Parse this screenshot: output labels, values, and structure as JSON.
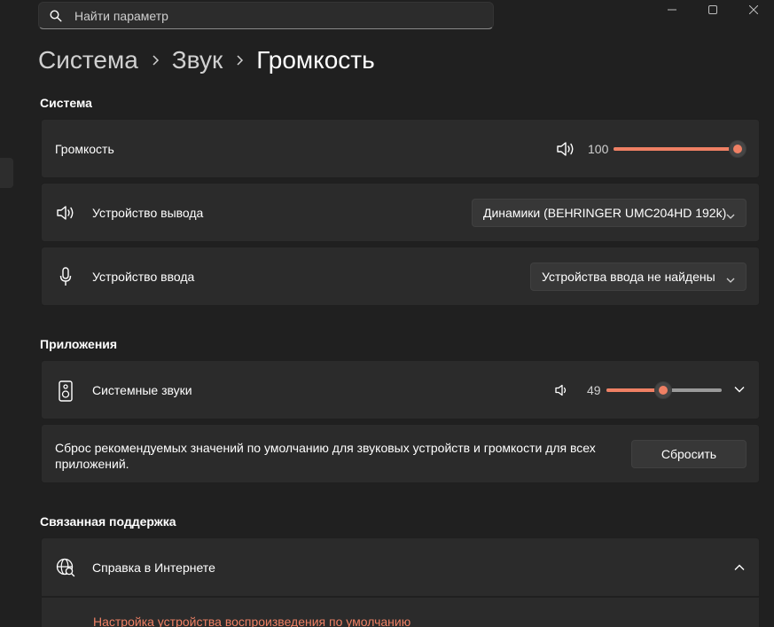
{
  "search": {
    "placeholder": "Найти параметр"
  },
  "breadcrumb": {
    "level1": "Система",
    "level2": "Звук",
    "current": "Громкость"
  },
  "sections": {
    "system": "Система",
    "apps": "Приложения",
    "support": "Связанная поддержка"
  },
  "system": {
    "volume": {
      "label": "Громкость",
      "value": "100",
      "level": 1.0
    },
    "output": {
      "label": "Устройство вывода",
      "selected": "Динамики (BEHRINGER UMC204HD 192k)"
    },
    "input": {
      "label": "Устройство ввода",
      "selected": "Устройства ввода не найдены"
    }
  },
  "apps": {
    "system_sounds": {
      "label": "Системные звуки",
      "value": "49",
      "level": 0.49
    },
    "reset": {
      "text": "Сброс рекомендуемых значений по умолчанию для звуковых устройств и громкости для всех приложений.",
      "button": "Сбросить"
    }
  },
  "support": {
    "help": {
      "label": "Справка в Интернете"
    },
    "links": [
      "Настройка устройства воспроизведения по умолчанию"
    ]
  },
  "colors": {
    "accent": "#ef8064",
    "background": "#202020",
    "card": "#2b2b2b"
  }
}
